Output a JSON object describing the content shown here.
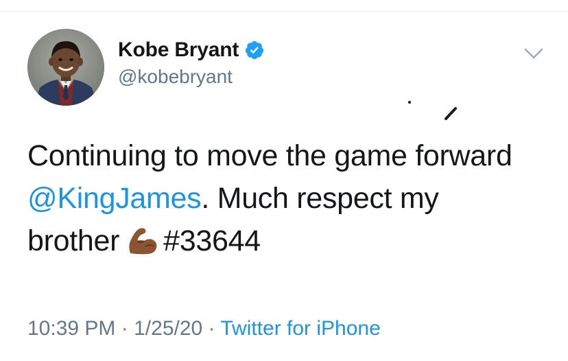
{
  "tweet": {
    "display_name": "Kobe Bryant",
    "handle": "@kobebryant",
    "verified": true,
    "text_line1": "Continuing to move the game forward",
    "mention": "@KingJames",
    "text_after_mention": ". Much respect my",
    "text_line3_start": "brother",
    "emoji": "flexed-biceps-medium-dark-skin",
    "hashtag": "#33644",
    "time": "10:39 PM",
    "date": "1/25/20",
    "separator": "·",
    "source": "Twitter for iPhone"
  },
  "colors": {
    "link": "#1b95e0",
    "verified": "#1da1f2",
    "text": "#14171a",
    "secondary": "#657786",
    "divider": "#e6ecf0"
  },
  "icons": {
    "avatar": "profile-photo",
    "verified": "verified-badge-icon",
    "menu": "chevron-down-icon"
  }
}
